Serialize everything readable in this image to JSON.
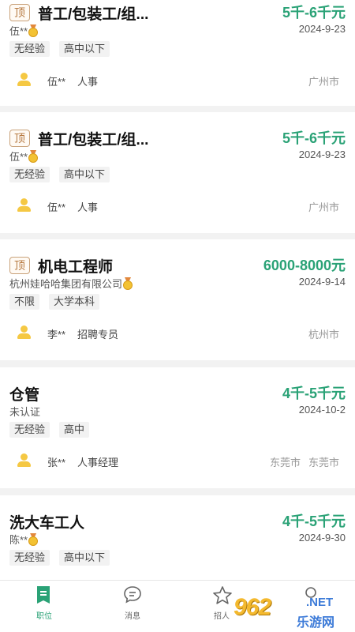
{
  "jobs": [
    {
      "pinned": true,
      "pin_label": "顶",
      "title": "普工/包装工/组...",
      "salary": "5千-6千元",
      "company": "伍**",
      "verified_medal": true,
      "date": "2024-9-23",
      "tags": [
        "无经验",
        "高中以下"
      ],
      "recruiter_name": "伍**",
      "recruiter_role": "人事",
      "cities": [
        "广州市"
      ]
    },
    {
      "pinned": true,
      "pin_label": "顶",
      "title": "普工/包装工/组...",
      "salary": "5千-6千元",
      "company": "伍**",
      "verified_medal": true,
      "date": "2024-9-23",
      "tags": [
        "无经验",
        "高中以下"
      ],
      "recruiter_name": "伍**",
      "recruiter_role": "人事",
      "cities": [
        "广州市"
      ]
    },
    {
      "pinned": true,
      "pin_label": "顶",
      "title": "机电工程师",
      "salary": "6000-8000元",
      "company": "杭州娃哈哈集团有限公司",
      "verified_medal": true,
      "date": "2024-9-14",
      "tags": [
        "不限",
        "大学本科"
      ],
      "recruiter_name": "李**",
      "recruiter_role": "招聘专员",
      "cities": [
        "杭州市"
      ]
    },
    {
      "pinned": false,
      "pin_label": "",
      "title": "仓管",
      "salary": "4千-5千元",
      "company": "未认证",
      "verified_medal": false,
      "date": "2024-10-2",
      "tags": [
        "无经验",
        "高中"
      ],
      "recruiter_name": "张**",
      "recruiter_role": "人事经理",
      "cities": [
        "东莞市",
        "东莞市"
      ]
    },
    {
      "pinned": false,
      "pin_label": "",
      "title": "洗大车工人",
      "salary": "4千-5千元",
      "company": "陈**",
      "verified_medal": true,
      "date": "2024-9-30",
      "tags": [
        "无经验",
        "高中以下"
      ],
      "recruiter_name": "",
      "recruiter_role": "",
      "cities": []
    }
  ],
  "tabbar": {
    "jobs": {
      "label": "职位",
      "icon": "document-icon",
      "active": true
    },
    "messages": {
      "label": "消息",
      "icon": "chat-bubble-icon"
    },
    "recruit": {
      "label": "招人",
      "icon": "star-icon"
    },
    "profile": {
      "label": "",
      "icon": "person-icon"
    }
  },
  "watermark": {
    "logo": "962",
    "net": ".NET",
    "sub": "乐游网"
  },
  "colors": {
    "salary": "#2aa276",
    "accent": "#2aa276",
    "badge": "#b77a42",
    "person_icon": "#f5c843"
  }
}
